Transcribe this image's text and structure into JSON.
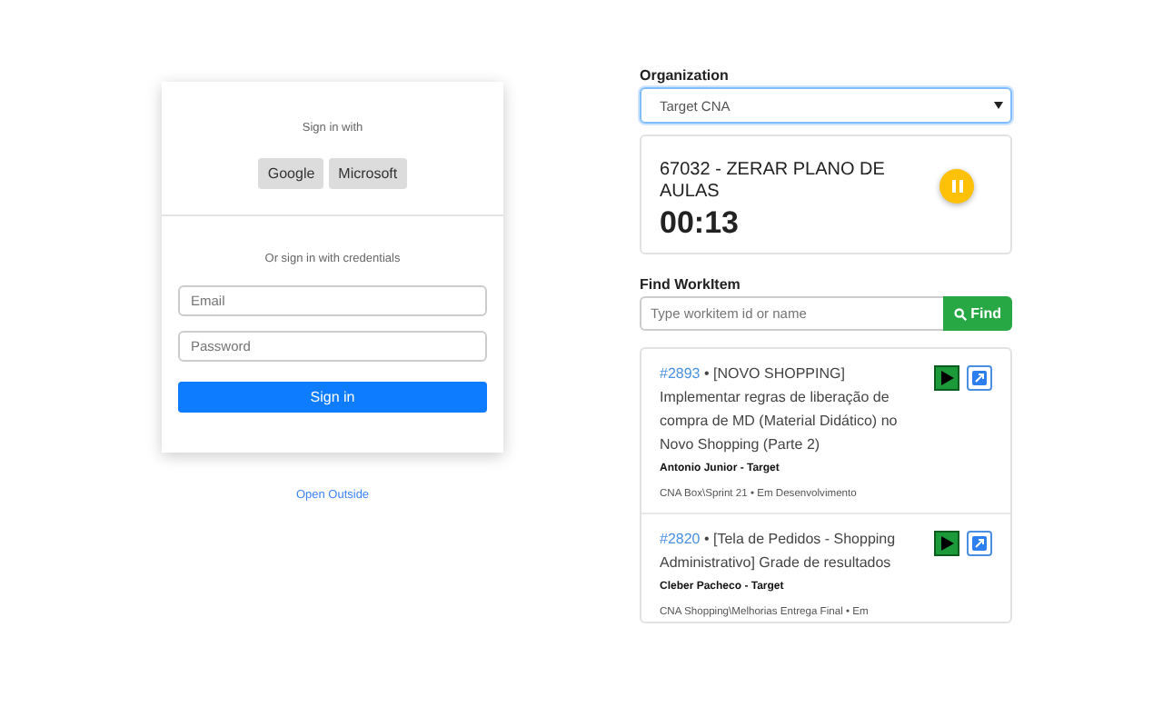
{
  "login": {
    "sign_in_with": "Sign in with",
    "providers": [
      "Google",
      "Microsoft"
    ],
    "credentials_hint": "Or sign in with credentials",
    "email_placeholder": "Email",
    "password_placeholder": "Password",
    "submit": "Sign in",
    "open_outside": "Open Outside"
  },
  "organization": {
    "label": "Organization",
    "value": "Target CNA"
  },
  "timer": {
    "title": "67032 - ZERAR PLANO DE AULAS",
    "elapsed": "00:13"
  },
  "find": {
    "label": "Find WorkItem",
    "placeholder": "Type workitem id or name",
    "button": "Find"
  },
  "workitems": [
    {
      "id": "#2893",
      "title": "• [NOVO SHOPPING] Implementar regras de liberação de compra de MD (Material Didático) no Novo Shopping (Parte 2)",
      "assignee": "Antonio Junior - Target",
      "meta": "CNA Box\\Sprint 21 • Em Desenvolvimento"
    },
    {
      "id": "#2820",
      "title": "• [Tela de Pedidos - Shopping Administrativo] Grade de resultados",
      "assignee": "Cleber Pacheco - Target",
      "meta": "CNA Shopping\\Melhorias Entrega Final • Em"
    }
  ]
}
